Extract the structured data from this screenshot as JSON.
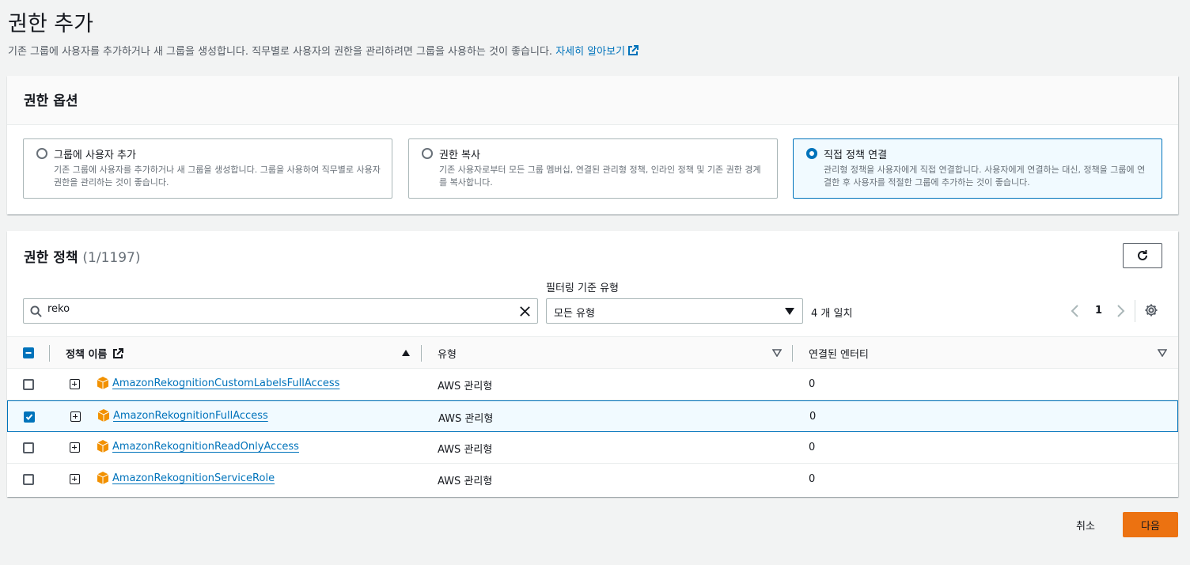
{
  "page": {
    "title": "권한 추가",
    "subtitle": "기존 그룹에 사용자를 추가하거나 새 그룹을 생성합니다. 직무별로 사용자의 권한을 관리하려면 그룹을 사용하는 것이 좋습니다.",
    "learn_more": "자세히 알아보기"
  },
  "options_panel": {
    "header": "권한 옵션",
    "options": [
      {
        "title": "그룹에 사용자 추가",
        "description": "기존 그룹에 사용자를 추가하거나 새 그룹을 생성합니다. 그룹을 사용하여 직무별로 사용자 권한을 관리하는 것이 좋습니다.",
        "selected": false
      },
      {
        "title": "권한 복사",
        "description": "기존 사용자로부터 모든 그룹 멤버십, 연결된 관리형 정책, 인라인 정책 및 기존 권한 경계를 복사합니다.",
        "selected": false
      },
      {
        "title": "직접 정책 연결",
        "description": "관리형 정책을 사용자에게 직접 연결합니다. 사용자에게 연결하는 대신, 정책을 그룹에 연결한 후 사용자를 적절한 그룹에 추가하는 것이 좋습니다.",
        "selected": true
      }
    ]
  },
  "policies_panel": {
    "title": "권한 정책",
    "count": "(1/1197)",
    "filter_label": "필터링 기준 유형",
    "search_value": "reko",
    "type_select": "모든 유형",
    "matches": "4 개 일치",
    "page_number": "1",
    "columns": {
      "name": "정책 이름",
      "type": "유형",
      "entities": "연결된 엔터티"
    },
    "rows": [
      {
        "name": "AmazonRekognitionCustomLabelsFullAccess",
        "type": "AWS 관리형",
        "entities": "0",
        "checked": false
      },
      {
        "name": "AmazonRekognitionFullAccess",
        "type": "AWS 관리형",
        "entities": "0",
        "checked": true
      },
      {
        "name": "AmazonRekognitionReadOnlyAccess",
        "type": "AWS 관리형",
        "entities": "0",
        "checked": false
      },
      {
        "name": "AmazonRekognitionServiceRole",
        "type": "AWS 관리형",
        "entities": "0",
        "checked": false
      }
    ]
  },
  "footer": {
    "cancel": "취소",
    "next": "다음"
  },
  "colors": {
    "accent": "#0073bb",
    "primary_button": "#ec7211",
    "aws_cube": "#f29100"
  }
}
